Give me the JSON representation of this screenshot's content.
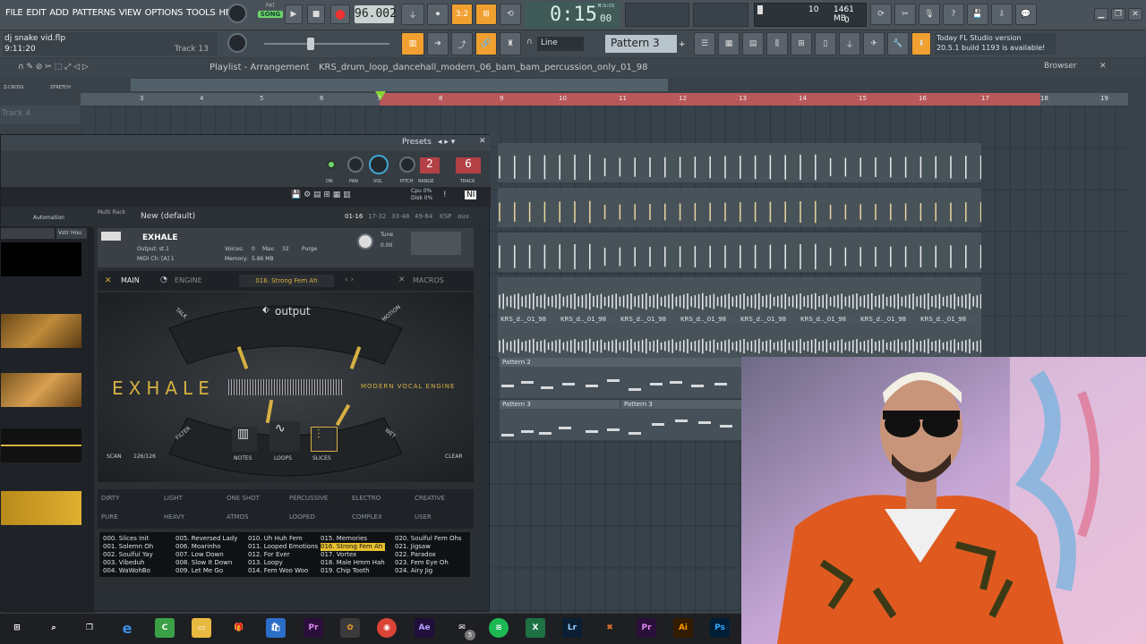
{
  "menu": [
    "FILE",
    "EDIT",
    "ADD",
    "PATTERNS",
    "VIEW",
    "OPTIONS",
    "TOOLS",
    "HELP"
  ],
  "transport": {
    "pat_label": "PAT",
    "song_label": "SONG",
    "tempo": "96.002",
    "time": "0:15",
    "time_sub": "00",
    "time_unit": "M:S:CS"
  },
  "project": {
    "file": "dj snake vid.flp",
    "time": "9:11:20",
    "track": "Track 13"
  },
  "monitor": {
    "cpu_val": "10",
    "mem": "1461 MB",
    "poly": "0"
  },
  "pattern_selector": {
    "snap": "Line",
    "pattern": "Pattern 3"
  },
  "news": {
    "line1": "Today  FL Studio version",
    "line2": "20.5.1 build 1193 is available!"
  },
  "playlist": {
    "title": "Playlist - Arrangement",
    "breadcrumb": "KRS_drum_loop_dancehall_modern_06_bam_bam_percussion_only_01_98",
    "browser": "Browser",
    "track_label": "Track 4",
    "zcross": "Z-CROSS",
    "stretch": "STRETCH"
  },
  "ruler": [
    "3",
    "4",
    "5",
    "6",
    "7",
    "8",
    "9",
    "10",
    "11",
    "12",
    "13",
    "14",
    "15",
    "16",
    "17",
    "18",
    "19"
  ],
  "clips": {
    "audio": [
      "KRS_d.._01_98",
      "KRS_d.._01_98",
      "KRS_d.._01_98",
      "KRS_d.._01_98",
      "KRS_d.._01_98",
      "KRS_d.._01_98",
      "KRS_d.._01_98",
      "KRS_d.._01_98"
    ],
    "p2": "Pattern 2",
    "p3a": "Pattern 3",
    "p3b": "Pattern 3"
  },
  "channel": {
    "presets": "Presets",
    "on": "ON",
    "pan": "PAN",
    "vol": "VOL",
    "pitch": "PITCH",
    "range": "RANGE",
    "track": "TRACK",
    "pitch_val": "2",
    "track_val": "6"
  },
  "kontakt": {
    "automation": "Automation",
    "host": "Vstr Hou",
    "multi_rack": "Multi Rack",
    "multi_name": "New (default)",
    "pages": [
      "01-16",
      "17-32",
      "33-48",
      "49-64",
      "KSP",
      "aux"
    ],
    "inst_name": "EXHALE",
    "output": "Output: st.1",
    "voices": "Voices:",
    "voices_val": "0",
    "max": "Max:",
    "max_val": "32",
    "purge": "Purge",
    "midi": "MIDI Ch: [A] 1",
    "memory": "Memory:",
    "memory_val": "5.86 MB",
    "tune": "Tune",
    "tune_val": "0.00",
    "cpu": "Cpu 0%",
    "disk": "Disk 0%",
    "nav_main": "MAIN",
    "nav_engine": "ENGINE",
    "nav_preset": "016. Strong Fem Ah",
    "nav_macros": "MACROS",
    "brand": "output",
    "logo": "EXHALE",
    "tagline": "MODERN VOCAL ENGINE",
    "arc_talk": "TALK",
    "arc_motion": "MOTION",
    "arc_filter": "FILTER",
    "arc_wet": "WET",
    "mode_notes": "NOTES",
    "mode_loops": "LOOPS",
    "mode_slices": "SLICES",
    "scan": "SCAN",
    "scan_val": "126/126",
    "clear": "CLEAR",
    "tags1": [
      "DIRTY",
      "LIGHT",
      "ONE SHOT",
      "PERCUSSIVE",
      "ELECTRO",
      "CREATIVE"
    ],
    "tags2": [
      "PURE",
      "HEAVY",
      "ATMOS",
      "LOOPED",
      "COMPLEX",
      "USER"
    ],
    "presets": [
      [
        "000. Slices Init",
        "001. Solemn Oh",
        "002. Soulful Yay",
        "003. Vibeduh",
        "004. WaWohBo"
      ],
      [
        "005. Reversed Lady",
        "006. Moarinho",
        "007. Low Down",
        "008. Slow It Down",
        "009. Let Me Go"
      ],
      [
        "010. Uh Huh Fem",
        "011. Looped Emotions",
        "012. For Ever",
        "013. Loopy",
        "014. Fem Woo Woo"
      ],
      [
        "015. Memories",
        "016. Strong Fem Ah",
        "017. Vortex",
        "018. Male Hmm Hah",
        "019. Chip Tooth"
      ],
      [
        "020. Soulful Fem Ohs",
        "021. Jigsaw",
        "022. Paradox",
        "023. Fem Eye Oh",
        "024. Airy Jig"
      ]
    ]
  },
  "taskbar": {
    "mail_badge": "5",
    "icons": [
      "windows-icon",
      "search-icon",
      "task-view-icon",
      "edge-icon",
      "camtasia-icon",
      "explorer-icon",
      "gift-icon",
      "store-icon",
      "premiere-icon",
      "fl-studio-icon",
      "chrome-icon",
      "after-effects-icon",
      "mail-icon",
      "spotify-icon",
      "excel-icon",
      "lightroom-icon",
      "app-icon",
      "premiere2-icon",
      "illustrator-icon",
      "photoshop-icon"
    ],
    "labels": {
      "pr": "Pr",
      "ae": "Ae",
      "lr": "Lr",
      "ai": "Ai",
      "ps": "Ps",
      "x": "X"
    }
  },
  "colors": {
    "accent_orange": "#f0a030",
    "song_green": "#6fd46a",
    "ruler_red": "#b8585a",
    "gold": "#d6b043"
  }
}
